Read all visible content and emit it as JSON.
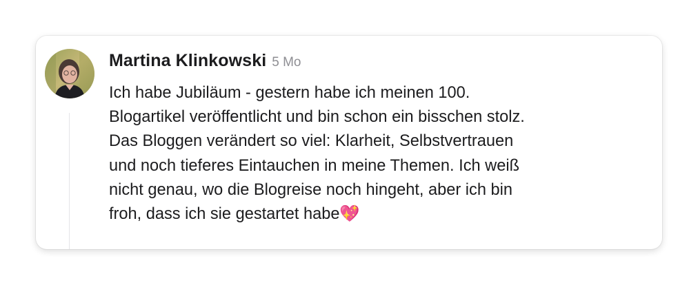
{
  "comment": {
    "author": "Martina Klinkowski",
    "timestamp": "5 Mo",
    "text": "Ich habe Jubiläum - gestern habe ich meinen 100.\nBlogartikel veröffentlicht und bin schon ein bisschen stolz.\nDas Bloggen verändert so viel: Klarheit, Selbstvertrauen\nund noch tieferes Eintauchen in meine Themen. Ich weiß\nnicht genau, wo die Blogreise noch hingeht, aber ich bin\nfroh, dass ich sie gestartet habe💖"
  }
}
